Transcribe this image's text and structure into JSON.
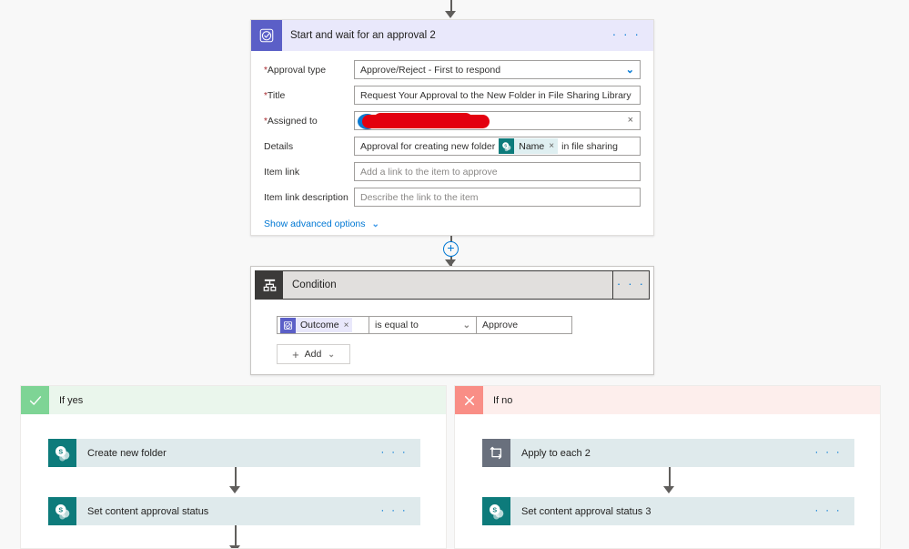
{
  "approval_card": {
    "title": "Start and wait for an approval 2",
    "icon": "approval-clock-check-icon",
    "menu": "· · ·",
    "fields": [
      {
        "label": "Approval type",
        "required": true,
        "value": "Approve/Reject - First to respond",
        "type": "dropdown"
      },
      {
        "label": "Title",
        "required": true,
        "value": "Request Your Approval to the New Folder in File Sharing Library",
        "type": "text"
      },
      {
        "label": "Assigned to",
        "required": true,
        "value": "",
        "type": "redacted",
        "note": "redacted-with-red-marker"
      },
      {
        "label": "Details",
        "required": false,
        "type": "tokenized",
        "prefix": "Approval for creating new folder",
        "token": "Name",
        "token_x": "×",
        "suffix": "in file sharing"
      },
      {
        "label": "Item link",
        "required": false,
        "value": "",
        "placeholder": "Add a link to the item to approve",
        "type": "text"
      },
      {
        "label": "Item link description",
        "required": false,
        "value": "",
        "placeholder": "Describe the link to the item",
        "type": "text"
      }
    ],
    "advanced_options_label": "Show advanced options",
    "advanced_chevron": "⌄"
  },
  "condition_card": {
    "title": "Condition",
    "icon": "condition-branch-icon",
    "menu": "· · ·",
    "row": {
      "left_token": "Outcome",
      "left_token_x": "×",
      "operator": "is equal to",
      "operator_chevron": "⌄",
      "right_value": "Approve"
    },
    "add_button": {
      "plus": "+",
      "label": "Add",
      "chevron": "⌄"
    }
  },
  "connectors": {
    "plus_glyph": "+"
  },
  "branch_yes": {
    "label": "If yes",
    "badge_icon": "checkmark-icon",
    "steps": [
      {
        "title": "Create new folder",
        "icon": "sharepoint-icon",
        "menu": "· · ·"
      },
      {
        "title": "Set content approval status",
        "icon": "sharepoint-icon",
        "menu": "· · ·"
      }
    ]
  },
  "branch_no": {
    "label": "If no",
    "badge_icon": "close-x-icon",
    "steps": [
      {
        "title": "Apply to each 2",
        "icon": "apply-to-each-loop-icon",
        "menu": "· · ·"
      },
      {
        "title": "Set content approval status 3",
        "icon": "sharepoint-icon",
        "menu": "· · ·"
      }
    ]
  },
  "colors": {
    "approval_purple": "#5b5fc7",
    "approval_header_bg": "#e9e8fb",
    "sharepoint_teal": "#0d7b7b",
    "loop_gray": "#69707d",
    "yes_green": "#7ed495",
    "no_red": "#f98e86",
    "accent_blue": "#0078d4",
    "redaction_red": "#e3000f"
  }
}
